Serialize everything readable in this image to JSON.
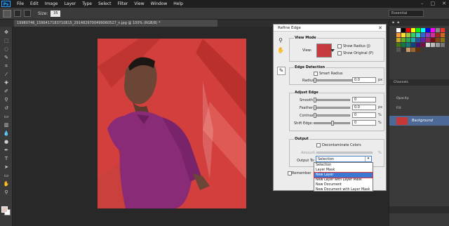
{
  "menubar": {
    "logo": "Ps",
    "items": [
      "File",
      "Edit",
      "Image",
      "Layer",
      "Type",
      "Select",
      "Filter",
      "View",
      "Window",
      "Help"
    ]
  },
  "options": {
    "size_label": "Size:",
    "size_value": "35",
    "workspace": "Essential"
  },
  "doc_tab": {
    "title": "19980746_1596417183710815_2914829700499060527_n.jpg @ 100% (RGB/8) *"
  },
  "panels": {
    "channels_label": "Channels",
    "opacity_label": "Opacity:",
    "fill_label": "Fill:",
    "layer_name": "Background"
  },
  "dialog": {
    "title": "Refine Edge",
    "view_mode": {
      "title": "View Mode",
      "view_label": "View:",
      "show_radius": "Show Radius (J)",
      "show_original": "Show Original (P)"
    },
    "edge_detection": {
      "title": "Edge Detection",
      "smart_radius": "Smart Radius",
      "radius_label": "Radius:",
      "radius_value": "0.0",
      "radius_unit": "px"
    },
    "adjust_edge": {
      "title": "Adjust Edge",
      "smooth_label": "Smooth:",
      "smooth_value": "0",
      "feather_label": "Feather:",
      "feather_value": "0.0",
      "feather_unit": "px",
      "contrast_label": "Contrast:",
      "contrast_value": "0",
      "contrast_unit": "%",
      "shift_label": "Shift Edge:",
      "shift_value": "0",
      "shift_unit": "%"
    },
    "output": {
      "title": "Output",
      "decontaminate": "Decontaminate Colors",
      "amount_label": "Amount:",
      "amount_unit": "%",
      "output_to_label": "Output To:",
      "output_to_value": "Selection",
      "remember_label": "Remember",
      "options": [
        "Selection",
        "Layer Mask",
        "New Layer",
        "New Layer with Layer Mask",
        "New Document",
        "New Document with Layer Mask"
      ]
    }
  },
  "colors": {
    "selection_highlight": "#3a78d4",
    "annotation_box": "#e03030",
    "photo_overlay": "#d23f3c"
  }
}
